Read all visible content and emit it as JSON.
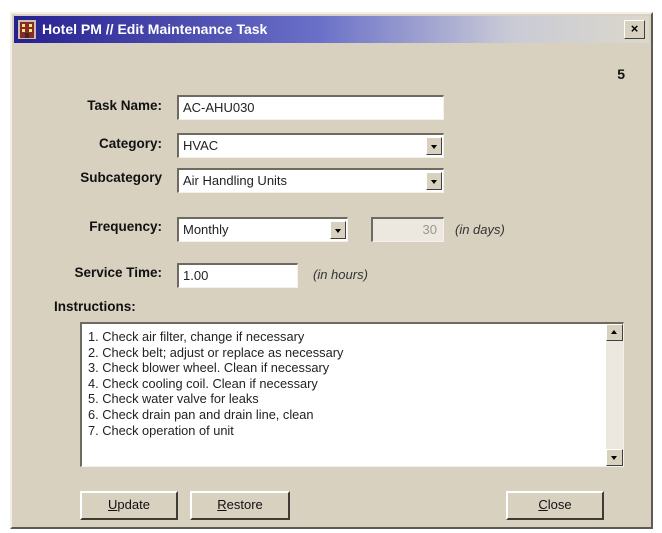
{
  "window": {
    "title": "Hotel PM // Edit Maintenance Task",
    "close_label": "×",
    "record_number": "5"
  },
  "form": {
    "task_name": {
      "label": "Task Name:",
      "value": "AC-AHU030"
    },
    "category": {
      "label": "Category:",
      "value": "HVAC"
    },
    "subcategory": {
      "label": "Subcategory",
      "value": "Air Handling Units"
    },
    "frequency": {
      "label": "Frequency:",
      "value": "Monthly",
      "days": "30",
      "days_hint": "(in days)"
    },
    "service_time": {
      "label": "Service Time:",
      "value": "1.00",
      "hint": "(in hours)"
    },
    "instructions": {
      "label": "Instructions:",
      "lines": [
        "1. Check air filter, change if necessary",
        "2. Check belt; adjust or replace as necessary",
        "3. Check blower wheel.  Clean if necessary",
        "4. Check cooling coil.  Clean if necessary",
        "5. Check water valve for leaks",
        "6. Check drain pan and drain line, clean",
        "7. Check operation of unit"
      ]
    }
  },
  "buttons": {
    "update": {
      "accel": "U",
      "rest": "pdate"
    },
    "restore": {
      "accel": "R",
      "rest": "estore"
    },
    "close": {
      "accel": "C",
      "rest": "lose"
    }
  },
  "icons": {
    "app": "hotel-building-icon",
    "dropdown": "chevron-down-icon"
  }
}
